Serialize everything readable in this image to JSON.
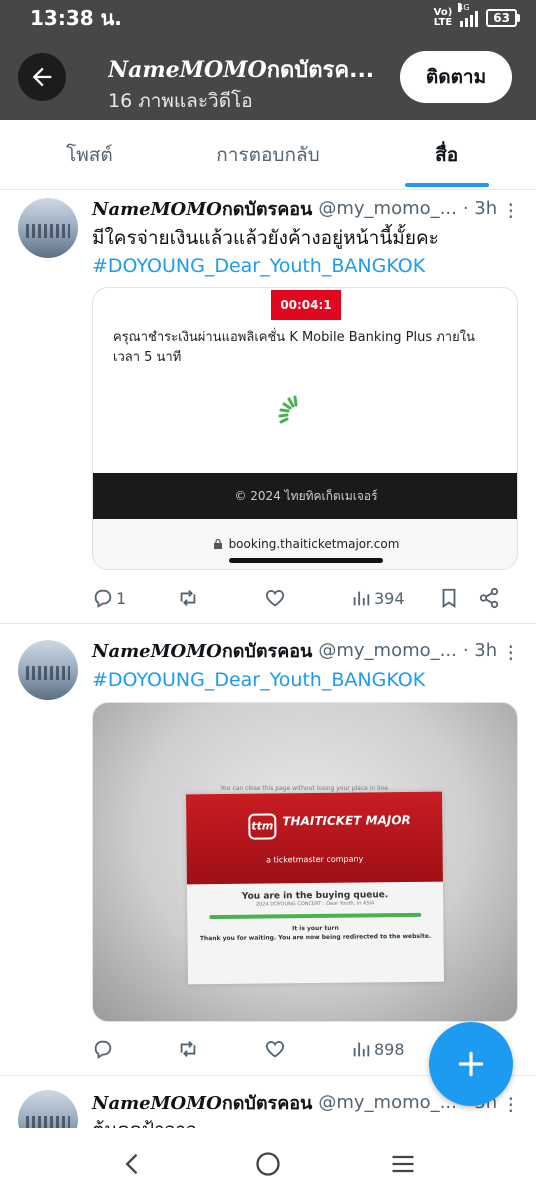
{
  "status_bar": {
    "time": "13:38 น.",
    "network": "VoLTE",
    "network_type": "4G",
    "battery": "63"
  },
  "header": {
    "title_deco": "NameMOMO",
    "title": "กดบัตรค...",
    "subtitle": "16 ภาพและวิดีโอ",
    "follow_label": "ติดตาม"
  },
  "tabs": [
    {
      "label": "โพสต์",
      "active": false
    },
    {
      "label": "การตอบกลับ",
      "active": false
    },
    {
      "label": "สื่อ",
      "active": true
    }
  ],
  "tweets": [
    {
      "name_deco": "NameMOMO",
      "name": "กดบัตรคอน",
      "handle": "@my_momo_...",
      "time": "· 3h",
      "text": "มีใครจ่ายเงินแล้วแล้วยังค้างอยู่หน้านี้มั้ยคะ",
      "hashtag": "#DOYOUNG_Dear_Youth_BANGKOK",
      "media": {
        "timer": "00:04:1",
        "message": "ครุณาชำระเงินผ่านแอพลิเคชั่น K Mobile Banking Plus ภายในเวลา 5 นาที",
        "footer": "© 2024 ไทยทิคเก็ตเมเจอร์",
        "url": "booking.thaiticketmajor.com"
      },
      "replies": "1",
      "reposts": "",
      "likes": "",
      "views": "394"
    },
    {
      "name_deco": "NameMOMO",
      "name": "กดบัตรคอน",
      "handle": "@my_momo_...",
      "time": "· 3h",
      "hashtag": "#DOYOUNG_Dear_Youth_BANGKOK",
      "photo": {
        "top_note": "You can close this page without losing your place in line.",
        "brand": "THAITICKET MAJOR",
        "brand_tag": "a ticketmaster company",
        "queue_title": "You are in the buying queue.",
        "queue_detail": "2024 DOYOUNG CONCERT : Dear Youth, in ASIA",
        "turn_title": "It is your turn",
        "turn_text": "Thank you for waiting. You are now being redirected to the website."
      },
      "replies": "",
      "reposts": "",
      "likes": "",
      "views": "898"
    },
    {
      "name_deco": "NameMOMO",
      "name": "กดบัตรคอน",
      "handle": "@my_momo_...",
      "time": "· 3h",
      "text": "ต้นดดป้าวาว"
    }
  ]
}
